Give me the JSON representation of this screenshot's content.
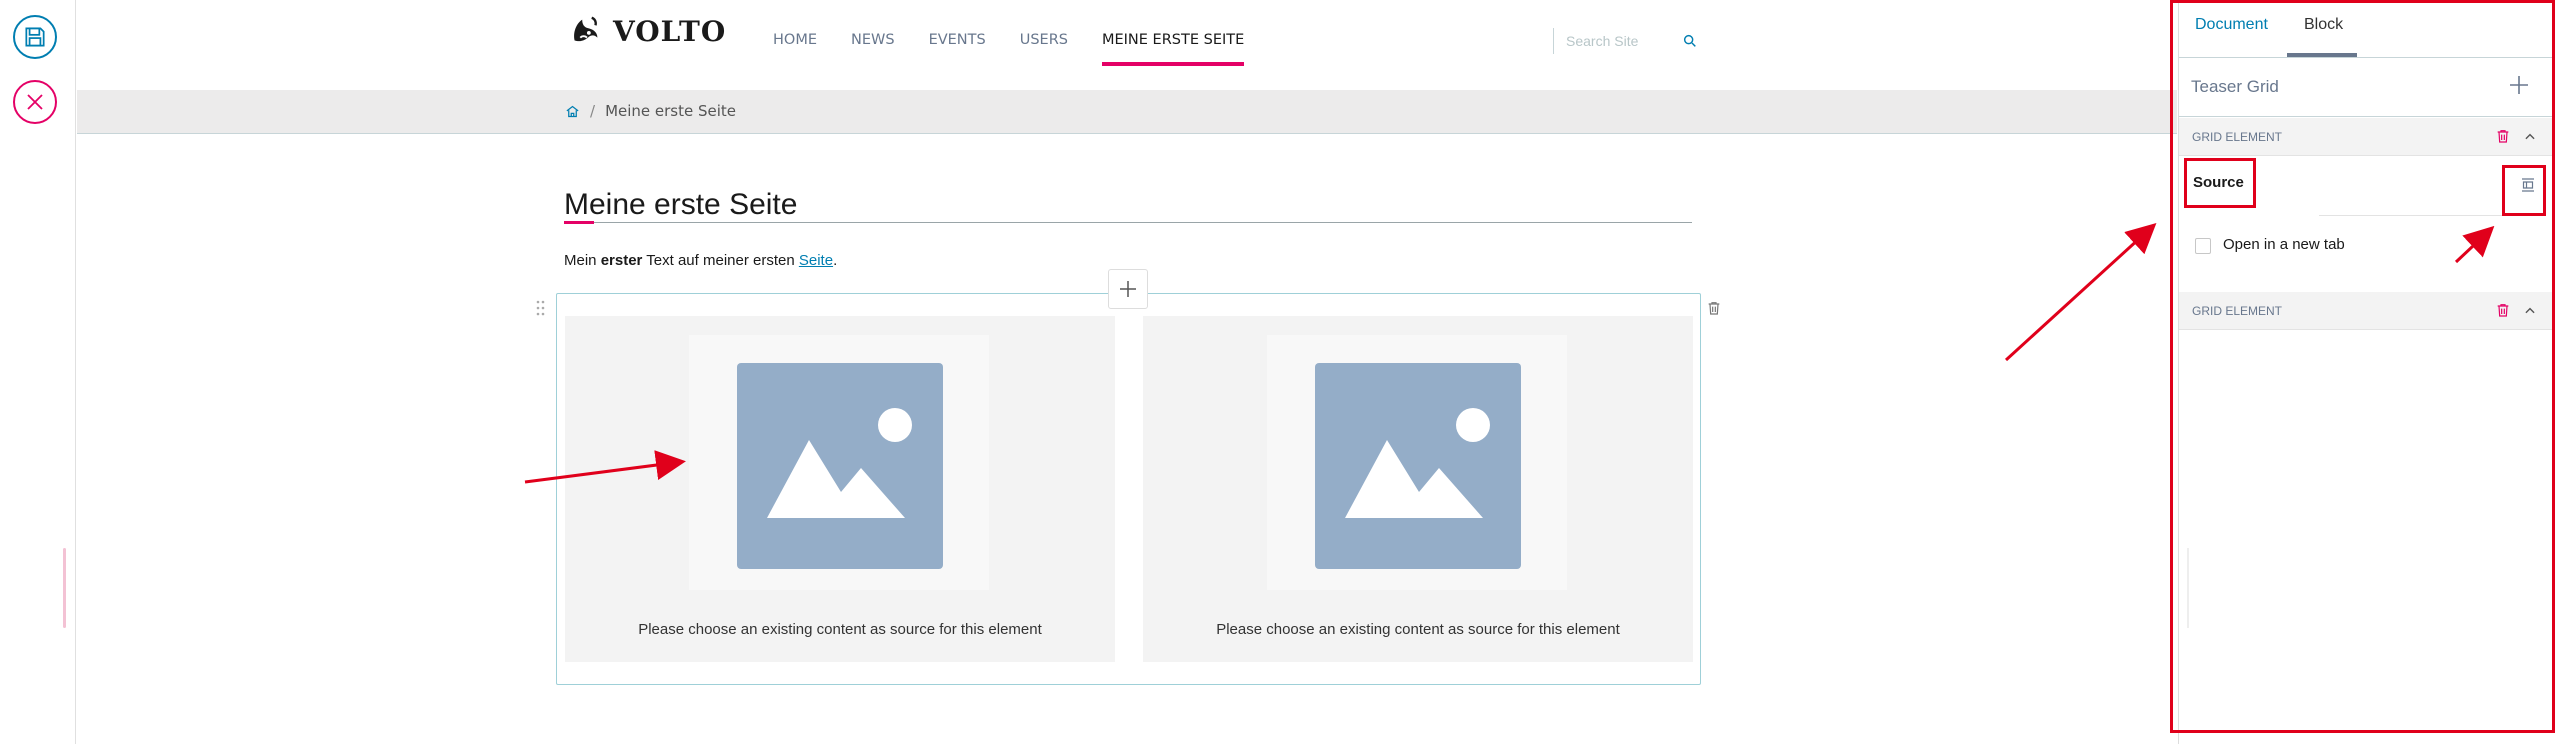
{
  "toolbar": {
    "save_icon": "save-icon",
    "cancel_icon": "close-icon",
    "save_color": "#007eb1",
    "cancel_color": "#e40166"
  },
  "header": {
    "logo_text": "VOLTO",
    "nav": [
      "HOME",
      "NEWS",
      "EVENTS",
      "USERS",
      "MEINE ERSTE SEITE"
    ],
    "active_nav": "MEINE ERSTE SEITE",
    "search_placeholder": "Search Site"
  },
  "breadcrumbs": {
    "sep": "/",
    "current": "Meine erste Seite"
  },
  "content": {
    "title": "Meine erste Seite",
    "intro_before": "Mein ",
    "intro_bold": "erster",
    "intro_middle": " Text auf meiner ersten ",
    "intro_link": "Seite",
    "intro_after": ".",
    "cells": [
      {
        "message": "Please choose an existing content as source for this element"
      },
      {
        "message": "Please choose an existing content as source for this element"
      }
    ]
  },
  "sidebar": {
    "tabs": [
      "Document",
      "Block"
    ],
    "active_tab": "Block",
    "block_title": "Teaser Grid",
    "grid_elements": [
      {
        "label": "GRID ELEMENT"
      },
      {
        "label": "GRID ELEMENT"
      }
    ],
    "source_label": "Source",
    "new_tab_label": "Open in a new tab",
    "new_tab_checked": false
  },
  "colors": {
    "accent_pink": "#e40166",
    "accent_blue": "#007eb1",
    "annotation_red": "#e0001b",
    "image_placeholder": "#94adc8"
  }
}
